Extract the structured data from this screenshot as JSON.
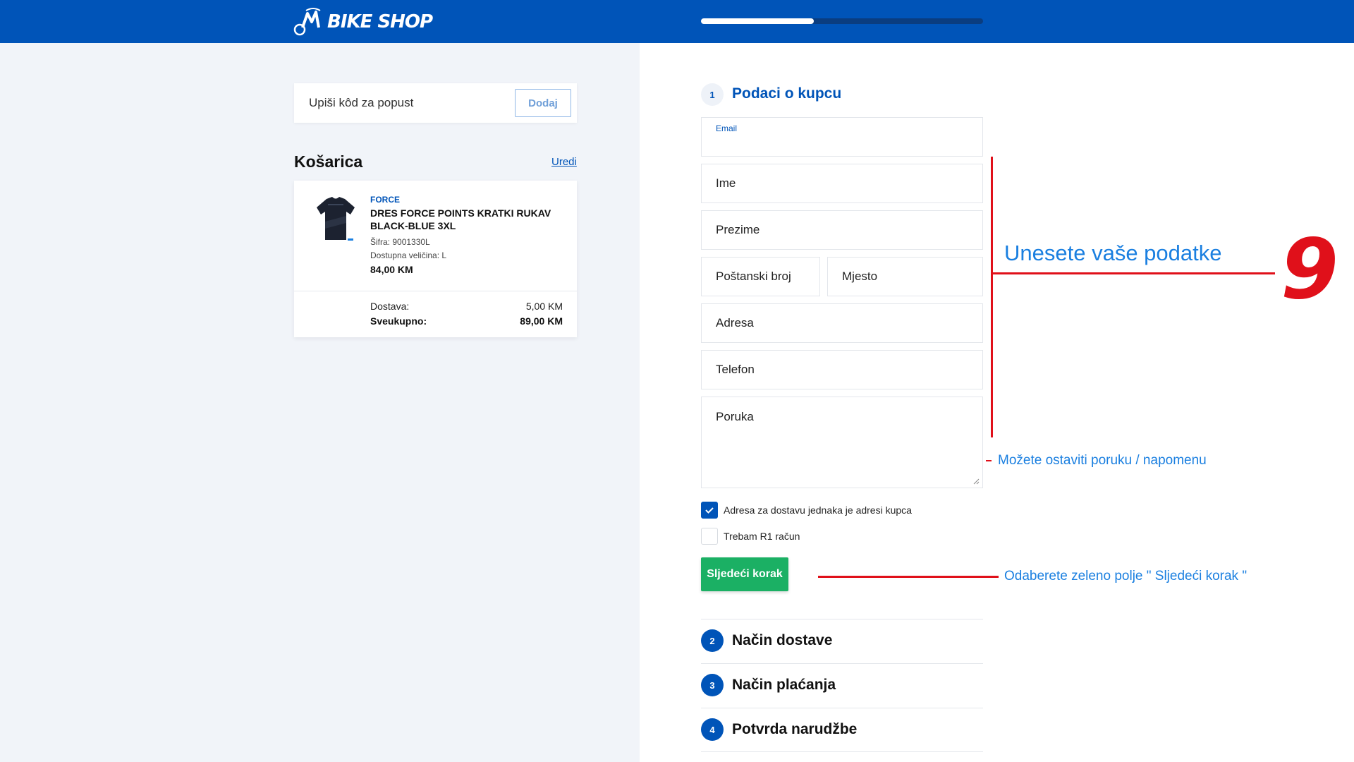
{
  "header": {
    "logo_text": "BIKE SHOP",
    "progress": 0.4,
    "brand_color": "#0054b8"
  },
  "coupon": {
    "placeholder": "Upiši kôd za popust",
    "button_label": "Dodaj"
  },
  "cart": {
    "title": "Košarica",
    "edit_label": "Uredi",
    "item": {
      "brand": "FORCE",
      "name": "DRES FORCE POINTS KRATKI RUKAV BLACK-BLUE 3XL",
      "sku": "Šifra: 9001330L",
      "size": "Dostupna veličina: L",
      "price": "84,00 KM"
    },
    "shipping_label": "Dostava:",
    "shipping_value": "5,00 KM",
    "total_label": "Sveukupno:",
    "total_value": "89,00 KM"
  },
  "form": {
    "step_number": "1",
    "step_title": "Podaci o kupcu",
    "email_label": "Email",
    "ime_placeholder": "Ime",
    "prezime_placeholder": "Prezime",
    "postanski_placeholder": "Poštanski broj",
    "mjesto_placeholder": "Mjesto",
    "adresa_placeholder": "Adresa",
    "telefon_placeholder": "Telefon",
    "poruka_placeholder": "Poruka",
    "checkbox_delivery_label": "Adresa za dostavu jednaka je adresi kupca",
    "checkbox_delivery_checked": true,
    "checkbox_r1_label": "Trebam R1 račun",
    "checkbox_r1_checked": false,
    "next_button": "Sljedeći korak"
  },
  "steps": [
    {
      "number": "2",
      "title": "Način dostave"
    },
    {
      "number": "3",
      "title": "Način plaćanja"
    },
    {
      "number": "4",
      "title": "Potvrda narudžbe"
    }
  ],
  "annotations": {
    "enter_data": "Unesete vaše podatke",
    "step_number": "9",
    "message_note": "Možete ostaviti poruku / napomenu",
    "next_note": "Odaberete zeleno polje \" Sljedeći korak \"",
    "color_line": "#e0101a",
    "color_text": "#1a7fe0"
  }
}
